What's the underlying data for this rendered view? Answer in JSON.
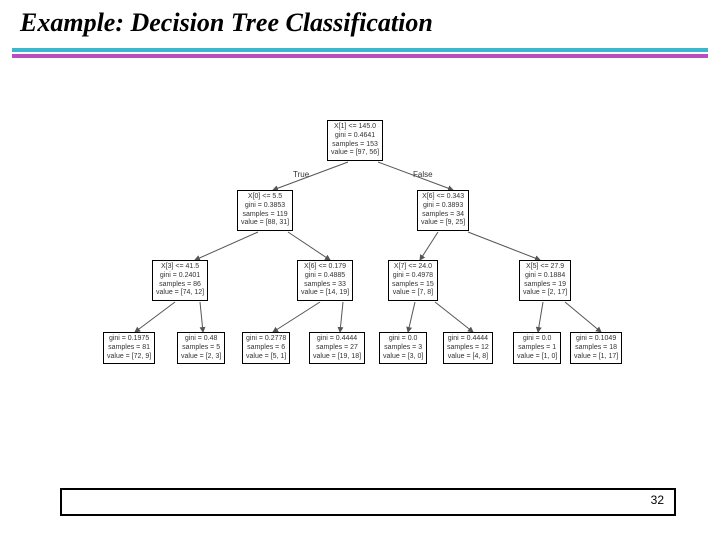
{
  "title": "Example: Decision Tree Classification",
  "page_number": "32",
  "edge_true": "True",
  "edge_false": "False",
  "nodes": {
    "n0": {
      "l1": "X[1] <= 145.0",
      "l2": "gini = 0.4641",
      "l3": "samples = 153",
      "l4": "value = [97, 56]"
    },
    "n1": {
      "l1": "X[0] <= 5.5",
      "l2": "gini = 0.3853",
      "l3": "samples = 119",
      "l4": "value = [88, 31]"
    },
    "n2": {
      "l1": "X[6] <= 0.343",
      "l2": "gini = 0.3893",
      "l3": "samples = 34",
      "l4": "value = [9, 25]"
    },
    "n3": {
      "l1": "X[3] <= 41.5",
      "l2": "gini = 0.2401",
      "l3": "samples = 86",
      "l4": "value = [74, 12]"
    },
    "n4": {
      "l1": "X[6] <= 0.179",
      "l2": "gini = 0.4885",
      "l3": "samples = 33",
      "l4": "value = [14, 19]"
    },
    "n5": {
      "l1": "X[7] <= 24.0",
      "l2": "gini = 0.4978",
      "l3": "samples = 15",
      "l4": "value = [7, 8]"
    },
    "n6": {
      "l1": "X[5] <= 27.9",
      "l2": "gini = 0.1884",
      "l3": "samples = 19",
      "l4": "value = [2, 17]"
    },
    "n7": {
      "l1": "gini = 0.1975",
      "l2": "samples = 81",
      "l3": "value = [72, 9]"
    },
    "n8": {
      "l1": "gini = 0.48",
      "l2": "samples = 5",
      "l3": "value = [2, 3]"
    },
    "n9": {
      "l1": "gini = 0.2778",
      "l2": "samples = 6",
      "l3": "value = [5, 1]"
    },
    "n10": {
      "l1": "gini = 0.4444",
      "l2": "samples = 27",
      "l3": "value = [19, 18]"
    },
    "n11": {
      "l1": "gini = 0.0",
      "l2": "samples = 3",
      "l3": "value = [3, 0]"
    },
    "n12": {
      "l1": "gini = 0.4444",
      "l2": "samples = 12",
      "l3": "value = [4, 8]"
    },
    "n13": {
      "l1": "gini = 0.0",
      "l2": "samples = 1",
      "l3": "value = [1, 0]"
    },
    "n14": {
      "l1": "gini = 0.1049",
      "l2": "samples = 18",
      "l3": "value = [1, 17]"
    }
  }
}
